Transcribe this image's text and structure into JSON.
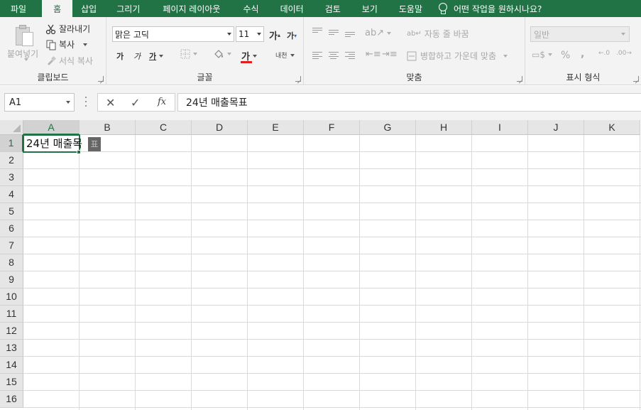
{
  "tabs": [
    "파일",
    "홈",
    "삽입",
    "그리기",
    "페이지 레이아웃",
    "수식",
    "데이터",
    "검토",
    "보기",
    "도움말"
  ],
  "active_tab": "홈",
  "tell_me": "어떤 작업을 원하시나요?",
  "ribbon": {
    "clipboard": {
      "label": "클립보드",
      "paste": "붙여넣기",
      "cut": "잘라내기",
      "copy": "복사",
      "format_painter": "서식 복사"
    },
    "font": {
      "label": "글꼴",
      "name": "맑은 고딕",
      "size": "11",
      "increase": "가",
      "decrease": "가",
      "bold": "가",
      "italic": "가",
      "underline": "가",
      "font_color": "가",
      "phonetic": "내천"
    },
    "alignment": {
      "label": "맞춤",
      "wrap_text": "자동 줄 바꿈",
      "merge_center": "병합하고 가운데 맞춤"
    },
    "number": {
      "label": "표시 형식",
      "format": "일반",
      "percent": "%",
      "comma": "9"
    }
  },
  "formula_bar": {
    "name_box": "A1",
    "content": "24년 매출목표"
  },
  "grid": {
    "columns": [
      "A",
      "B",
      "C",
      "D",
      "E",
      "F",
      "G",
      "H",
      "I",
      "J",
      "K"
    ],
    "rows": [
      "1",
      "2",
      "3",
      "4",
      "5",
      "6",
      "7",
      "8",
      "9",
      "10",
      "11",
      "12",
      "13",
      "14",
      "15",
      "16"
    ],
    "active_cell": "A1",
    "a1_text": "24년 매출목",
    "ime_composing": "표"
  },
  "colors": {
    "accent": "#217346",
    "font_color_bar": "#e02020"
  }
}
